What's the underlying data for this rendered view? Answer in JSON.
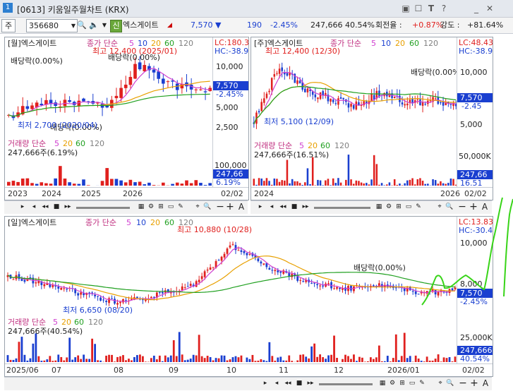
{
  "window": {
    "icon_label": "1",
    "title": "[0613] 키움일주월차트 (KRX)",
    "buttons": [
      "▣",
      "☐",
      "T",
      "?",
      "_",
      "✕"
    ]
  },
  "toolbar": {
    "market": "주",
    "code": "356680",
    "sin_badge": "신",
    "name": "엑스게이트",
    "price": "7,570",
    "arrow": "▼",
    "change": "190",
    "change_rate": "-2.45%",
    "volume": "247,666",
    "vol_rate": "40.54%",
    "turnover_label": "회전율 :",
    "turnover": "+0.87%",
    "strength_label": "강도 :",
    "strength": "+81.64%"
  },
  "monthly": {
    "title": "[월]엑스게이트",
    "ma_label": "종가 단순",
    "ma": [
      "5",
      "10",
      "20",
      "60",
      "120"
    ],
    "high_label": "최고 12,400 (2025/01)",
    "low_label": "최저 2,700 (2020/04)",
    "div1": "배당락(0.00%)",
    "div2": "배당락(0.00%)",
    "div3": "배당락(0.00%)",
    "lc": "LC:180.3",
    "hc": "HC:-38.9",
    "scale": [
      "10,000",
      "7,570",
      "-2.45%",
      "5,000",
      "2,500"
    ],
    "vol_label": "거래량 단순",
    "vol_ma": [
      "5",
      "20",
      "60",
      "120"
    ],
    "vol_value": "247,666주(6.19%)",
    "vol_scale": [
      "100,000",
      "247,66",
      "6.19%"
    ],
    "dates": [
      "2023",
      "2024",
      "2025",
      "2026"
    ],
    "date_corner": "02/02"
  },
  "weekly": {
    "title": "[주]엑스게이트",
    "ma_label": "종가 단순",
    "ma": [
      "5",
      "10",
      "20",
      "60",
      "120"
    ],
    "high_label": "최고 12,400 (12/30)",
    "low_label": "최저 5,100 (12/09)",
    "div1": "배당락(0.00%)",
    "lc": "LC:48.43",
    "hc": "HC:-38.9",
    "scale": [
      "10,000",
      "7,570",
      "-2.45",
      "5,000"
    ],
    "vol_label": "거래량 단순",
    "vol_ma": [
      "5",
      "20",
      "60",
      "120"
    ],
    "vol_value": "247,666주(16.51%)",
    "vol_scale": [
      "50,000K",
      "247,66",
      "16.51"
    ],
    "dates": [
      "2024",
      "2026"
    ],
    "date_corner": "02/02"
  },
  "daily": {
    "title": "[일]엑스게이트",
    "ma_label": "종가 단순",
    "ma": [
      "5",
      "10",
      "20",
      "60",
      "120"
    ],
    "high_label": "최고 10,880 (10/28)",
    "low_label": "최저 6,650 (08/20)",
    "div1": "배당락(0.00%)",
    "lc": "LC:13.83",
    "hc": "HC:-30.42",
    "scale": [
      "10,000",
      "8,000",
      "7,570",
      "-2.45%"
    ],
    "vol_label": "거래량 단순",
    "vol_ma": [
      "5",
      "20",
      "60",
      "120"
    ],
    "vol_value": "247,666주(40.54%)",
    "vol_scale": [
      "25,000K",
      "247,666",
      "40.54%"
    ],
    "dates": [
      "2025/06",
      "07",
      "08",
      "09",
      "10",
      "11",
      "12",
      "2026/01"
    ],
    "date_corner": "02/02"
  },
  "minibar": {
    "buttons": [
      "▸",
      "◂",
      "◂◂",
      "■",
      "▸▸"
    ],
    "zoom_minus": "−",
    "zoom_plus": "+",
    "font_a": "A"
  },
  "colors": {
    "up": "#e0201e",
    "down": "#1a3fd0",
    "ma5": "#d040d0",
    "ma20": "#e8a000",
    "ma60": "#20a020",
    "ma120": "#808080",
    "annot_green": "#38d418"
  }
}
